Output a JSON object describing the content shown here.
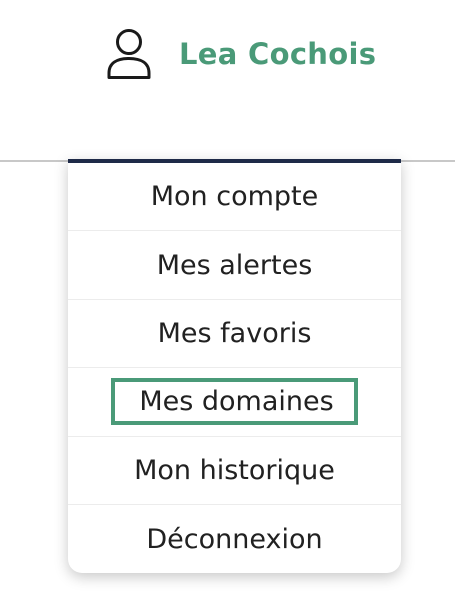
{
  "user": {
    "name": "Lea Cochois",
    "icon": "user-icon"
  },
  "menu": {
    "items": [
      {
        "label": "Mon compte",
        "highlighted": false
      },
      {
        "label": "Mes alertes",
        "highlighted": false
      },
      {
        "label": "Mes favoris",
        "highlighted": false
      },
      {
        "label": "Mes domaines",
        "highlighted": true
      },
      {
        "label": "Mon historique",
        "highlighted": false
      },
      {
        "label": "Déconnexion",
        "highlighted": false
      }
    ]
  },
  "colors": {
    "accent": "#4a9a78",
    "dropdown_border": "#1e2a48",
    "text": "#212121"
  }
}
